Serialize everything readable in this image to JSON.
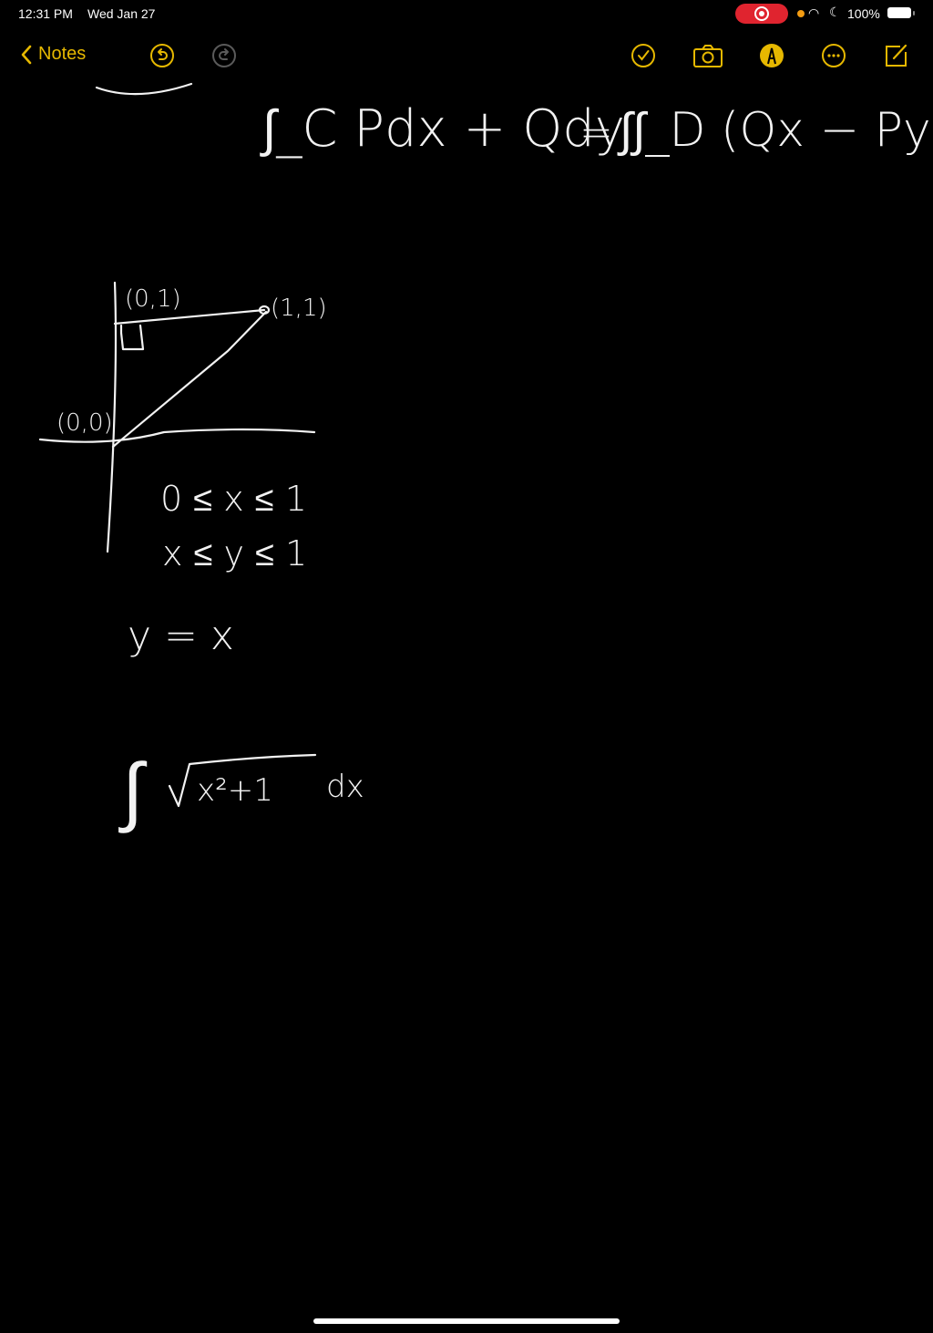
{
  "status_bar": {
    "time": "12:31 PM",
    "date": "Wed Jan 27",
    "battery": "100%",
    "recording": true
  },
  "toolbar": {
    "back_label": "Notes",
    "accent_color": "#e6b800",
    "icons": [
      "undo-icon",
      "redo-icon",
      "checklist-icon",
      "camera-icon",
      "markup-pen-icon",
      "more-icon",
      "compose-icon"
    ]
  },
  "note": {
    "greens_theorem": {
      "lhs": "∫_C Pdx + Qdy",
      "eq": "=",
      "rhs": "∫∫_D (Qx − Py) dA"
    },
    "diagram_labels": {
      "top_left": "(0,1)",
      "top_right": "(1,1)",
      "origin": "(0,0)"
    },
    "bounds": [
      "0 ≤ x ≤ 1",
      "x ≤ y ≤ 1"
    ],
    "line": "y = x",
    "integral": {
      "sign": "∫",
      "radicand": "x²+1",
      "differential": "dx"
    }
  }
}
